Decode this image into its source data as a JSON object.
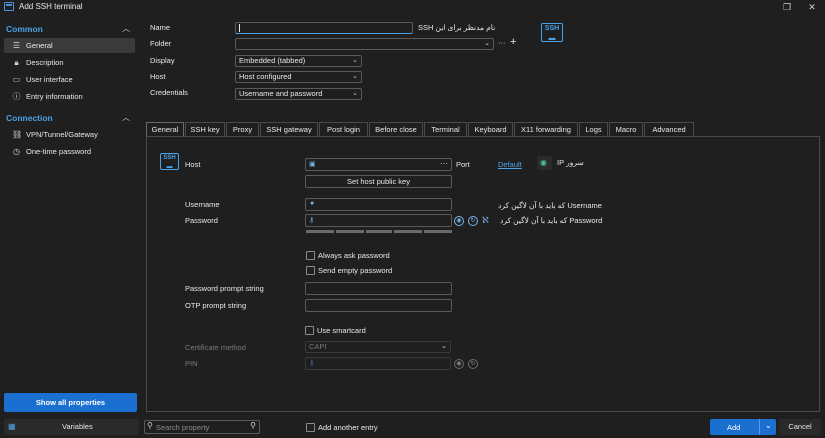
{
  "window": {
    "title": "Add SSH terminal"
  },
  "sidebar": {
    "common_label": "Common",
    "connection_label": "Connection",
    "common_items": [
      {
        "label": "General",
        "icon": "list-icon"
      },
      {
        "label": "Description",
        "icon": "lock-icon"
      },
      {
        "label": "User interface",
        "icon": "monitor-icon"
      },
      {
        "label": "Entry information",
        "icon": "info-icon"
      }
    ],
    "connection_items": [
      {
        "label": "VPN/Tunnel/Gateway",
        "icon": "link-icon"
      },
      {
        "label": "One-time password",
        "icon": "clock-icon"
      }
    ],
    "show_all_label": "Show all properties"
  },
  "header": {
    "name_label": "Name",
    "name_placeholder": "نام مدنظر برای این SSH",
    "folder_label": "Folder",
    "display_label": "Display",
    "display_value": "Embedded (tabbed)",
    "host_label": "Host",
    "host_value": "Host configured",
    "credentials_label": "Credentials",
    "credentials_value": "Username and password"
  },
  "tabs": [
    "General",
    "SSH key",
    "Proxy",
    "SSH gateway",
    "Post login",
    "Before close",
    "Terminal",
    "Keyboard",
    "X11 forwarding",
    "Logs",
    "Macro",
    "Advanced"
  ],
  "general": {
    "host_label": "Host",
    "port_label": "Port",
    "port_value": "Default",
    "host_hint": "سرور IP",
    "set_host_key_label": "Set host public key",
    "username_label": "Username",
    "username_hint": "Username که باید با آن لاگین کرد",
    "password_label": "Password",
    "password_hint": "Password که باید با آن لاگین کرد",
    "always_ask_label": "Always ask password",
    "send_empty_label": "Send empty password",
    "pw_prompt_label": "Password prompt string",
    "otp_prompt_label": "OTP prompt string",
    "use_smartcard_label": "Use smartcard",
    "cert_method_label": "Certificate method",
    "cert_method_value": "CAPI",
    "pin_label": "PIN"
  },
  "footer": {
    "variables_label": "Variables",
    "search_placeholder": "Search property",
    "add_another_label": "Add another entry",
    "add_label": "Add",
    "cancel_label": "Cancel"
  },
  "colors": {
    "accent": "#1b6fd0",
    "link": "#4aa3e8",
    "background": "#1f1f1f"
  }
}
